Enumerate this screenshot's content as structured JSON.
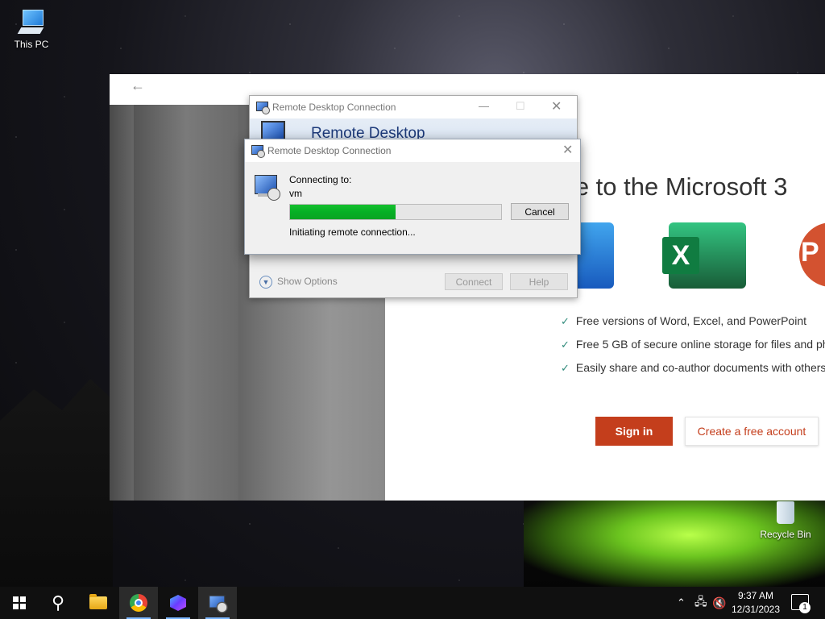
{
  "desktop": {
    "icons": [
      {
        "label": "This PC"
      },
      {
        "label": "Recycle Bin"
      }
    ]
  },
  "office": {
    "welcome_text": "me to the Microsoft 3",
    "features": [
      "Free versions of Word, Excel, and PowerPoint",
      "Free 5 GB of secure online storage for files and ph",
      "Easily share and co-author documents with others"
    ],
    "signin_label": "Sign in",
    "create_label": "Create a free account",
    "excel_letter": "X",
    "ppt_letter": "P"
  },
  "rdc_main": {
    "title": "Remote Desktop Connection",
    "banner": "Remote Desktop",
    "show_options": "Show Options",
    "connect_label": "Connect",
    "help_label": "Help"
  },
  "rdc_dialog": {
    "title": "Remote Desktop Connection",
    "connecting_label": "Connecting to:",
    "host": "vm",
    "progress": 0.5,
    "cancel_label": "Cancel",
    "status": "Initiating remote connection..."
  },
  "taskbar": {
    "clock_time": "9:37 AM",
    "clock_date": "12/31/2023",
    "notification_count": "1",
    "apps": [
      "start",
      "search",
      "file-explorer",
      "chrome",
      "copilot",
      "remote-desktop"
    ],
    "indicator_color": "#7bb6ff"
  },
  "colors": {
    "office_accent": "#c43e1c",
    "progress_green": "#06b025"
  }
}
